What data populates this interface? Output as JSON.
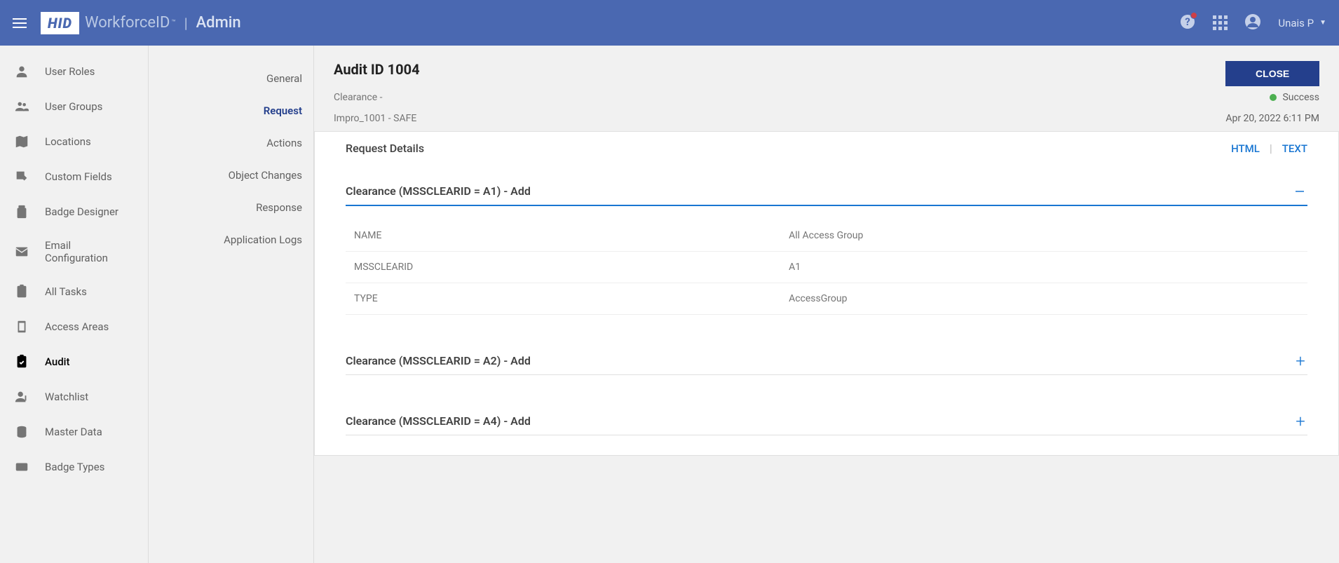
{
  "header": {
    "logo_text": "HID",
    "brand": "WorkforceID",
    "tm": "™",
    "separator": "|",
    "admin": "Admin",
    "user_name": "Unais P"
  },
  "sidebar": {
    "items": [
      {
        "label": "User Roles"
      },
      {
        "label": "User Groups"
      },
      {
        "label": "Locations"
      },
      {
        "label": "Custom Fields"
      },
      {
        "label": "Badge Designer"
      },
      {
        "label": "Email Configuration"
      },
      {
        "label": "All Tasks"
      },
      {
        "label": "Access Areas"
      },
      {
        "label": "Audit"
      },
      {
        "label": "Watchlist"
      },
      {
        "label": "Master Data"
      },
      {
        "label": "Badge Types"
      }
    ]
  },
  "inner_nav": {
    "items": [
      {
        "label": "General"
      },
      {
        "label": "Request"
      },
      {
        "label": "Actions"
      },
      {
        "label": "Object Changes"
      },
      {
        "label": "Response"
      },
      {
        "label": "Application Logs"
      }
    ]
  },
  "detail": {
    "title": "Audit ID 1004",
    "subtitle": "Clearance -",
    "source": "Impro_1001 - SAFE",
    "close_label": "CLOSE",
    "status": "Success",
    "date": "Apr 20, 2022 6:11 PM",
    "request_details_title": "Request Details",
    "view_html": "HTML",
    "view_sep": "|",
    "view_text": "TEXT",
    "sections": [
      {
        "title": "Clearance (MSSCLEARID = A1) - Add",
        "expanded": true,
        "rows": [
          {
            "k": "NAME",
            "v": "All Access Group"
          },
          {
            "k": "MSSCLEARID",
            "v": "A1"
          },
          {
            "k": "TYPE",
            "v": "AccessGroup"
          }
        ]
      },
      {
        "title": "Clearance (MSSCLEARID = A2) - Add",
        "expanded": false
      },
      {
        "title": "Clearance (MSSCLEARID = A4) - Add",
        "expanded": false
      }
    ]
  }
}
